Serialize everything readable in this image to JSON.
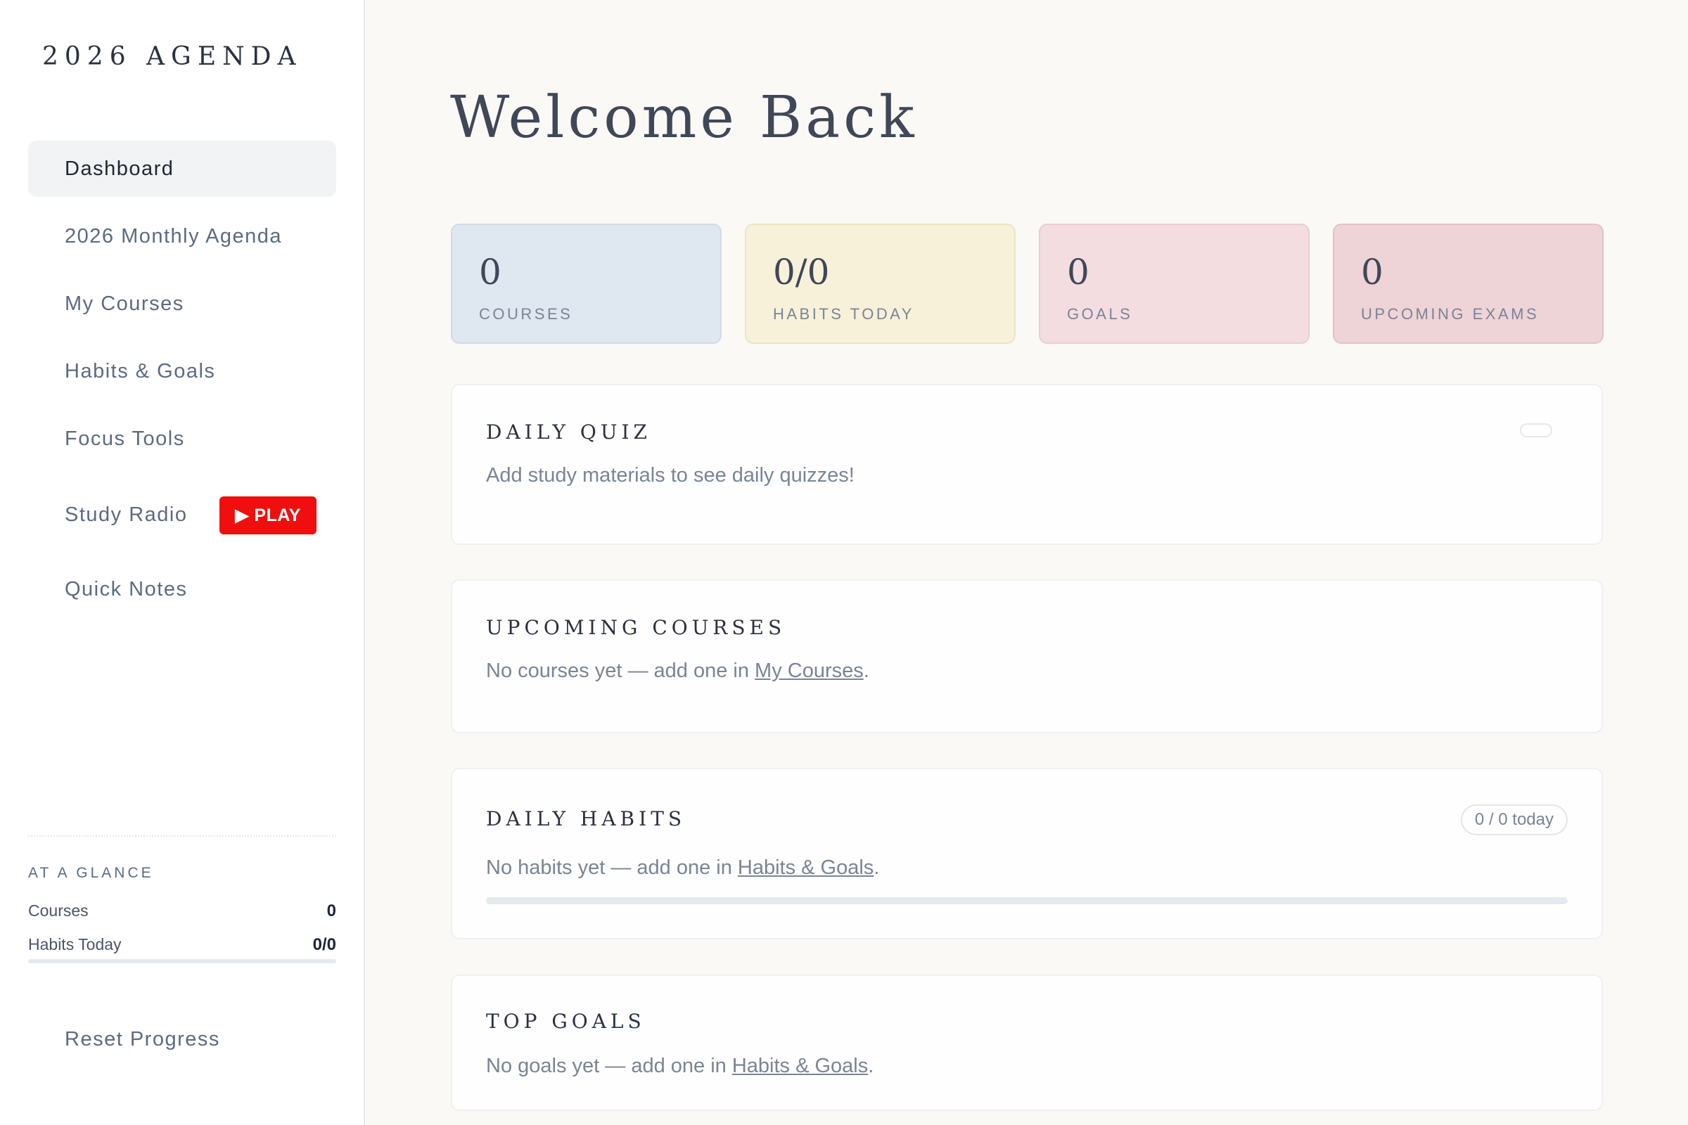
{
  "sidebar": {
    "brand": "2026 AGENDA",
    "nav": [
      {
        "label": "Dashboard",
        "active": true
      },
      {
        "label": "2026 Monthly Agenda"
      },
      {
        "label": "My Courses"
      },
      {
        "label": "Habits & Goals"
      },
      {
        "label": "Focus Tools"
      },
      {
        "label": "Study Radio"
      },
      {
        "label": "Quick Notes"
      }
    ],
    "play_label": "▶ PLAY",
    "glance": {
      "title": "AT A GLANCE",
      "courses_label": "Courses",
      "courses_value": "0",
      "habits_label": "Habits Today",
      "habits_value": "0/0",
      "habits_progress": 0
    },
    "reset_label": "Reset Progress"
  },
  "main": {
    "title": "Welcome Back",
    "stats": [
      {
        "value": "0",
        "label": "COURSES",
        "color": "#dfe7f0",
        "border": "#cfdbe8"
      },
      {
        "value": "0/0",
        "label": "HABITS TODAY",
        "color": "#f7f1d9",
        "border": "#ede4c2"
      },
      {
        "value": "0",
        "label": "GOALS",
        "color": "#f3dde0",
        "border": "#e9cdd1"
      },
      {
        "value": "0",
        "label": "UPCOMING EXAMS",
        "color": "#eed3d7",
        "border": "#e3c2c7"
      }
    ],
    "daily_quiz": {
      "title": "DAILY QUIZ",
      "text": "Add study materials to see daily quizzes!"
    },
    "upcoming_courses": {
      "title": "UPCOMING COURSES",
      "text_before": "No courses yet — add one in ",
      "link": "My Courses",
      "text_after": "."
    },
    "daily_habits": {
      "title": "DAILY HABITS",
      "badge": "0 / 0 today",
      "text_before": "No habits yet — add one in ",
      "link": "Habits & Goals",
      "text_after": ".",
      "progress": 0
    },
    "top_goals": {
      "title": "TOP GOALS",
      "text_before": "No goals yet — add one in ",
      "link": "Habits & Goals",
      "text_after": "."
    }
  }
}
